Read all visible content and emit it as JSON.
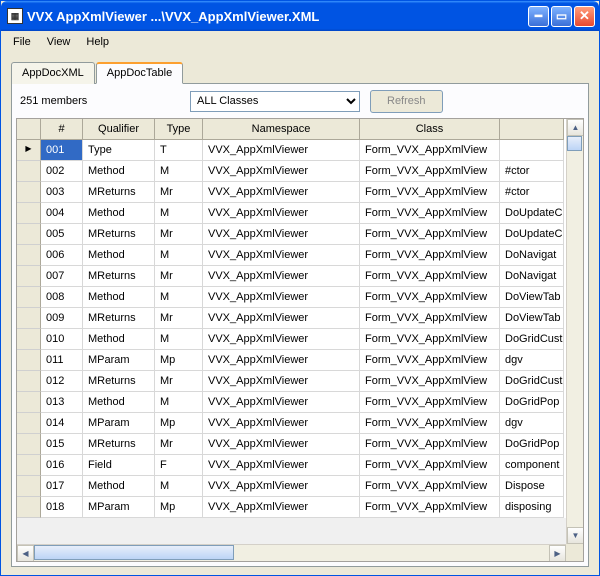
{
  "window": {
    "title": "VVX AppXmlViewer ...\\VVX_AppXmlViewer.XML"
  },
  "menu": {
    "file": "File",
    "view": "View",
    "help": "Help"
  },
  "tabs": {
    "xml": "AppDocXML",
    "table": "AppDocTable"
  },
  "toolbar": {
    "members": "251 members",
    "filter": "ALL Classes",
    "refresh": "Refresh"
  },
  "columns": [
    "#",
    "Qualifier",
    "Type",
    "Namespace",
    "Class",
    ""
  ],
  "rows": [
    {
      "n": "001",
      "q": "Type",
      "t": "T",
      "ns": "VVX_AppXmlViewer",
      "cls": "Form_VVX_AppXmlView",
      "m": ""
    },
    {
      "n": "002",
      "q": "Method",
      "t": "M",
      "ns": "VVX_AppXmlViewer",
      "cls": "Form_VVX_AppXmlView",
      "m": "#ctor"
    },
    {
      "n": "003",
      "q": "MReturns",
      "t": "Mr",
      "ns": "VVX_AppXmlViewer",
      "cls": "Form_VVX_AppXmlView",
      "m": "#ctor"
    },
    {
      "n": "004",
      "q": "Method",
      "t": "M",
      "ns": "VVX_AppXmlViewer",
      "cls": "Form_VVX_AppXmlView",
      "m": "DoUpdateC"
    },
    {
      "n": "005",
      "q": "MReturns",
      "t": "Mr",
      "ns": "VVX_AppXmlViewer",
      "cls": "Form_VVX_AppXmlView",
      "m": "DoUpdateC"
    },
    {
      "n": "006",
      "q": "Method",
      "t": "M",
      "ns": "VVX_AppXmlViewer",
      "cls": "Form_VVX_AppXmlView",
      "m": "DoNavigat"
    },
    {
      "n": "007",
      "q": "MReturns",
      "t": "Mr",
      "ns": "VVX_AppXmlViewer",
      "cls": "Form_VVX_AppXmlView",
      "m": "DoNavigat"
    },
    {
      "n": "008",
      "q": "Method",
      "t": "M",
      "ns": "VVX_AppXmlViewer",
      "cls": "Form_VVX_AppXmlView",
      "m": "DoViewTab"
    },
    {
      "n": "009",
      "q": "MReturns",
      "t": "Mr",
      "ns": "VVX_AppXmlViewer",
      "cls": "Form_VVX_AppXmlView",
      "m": "DoViewTab"
    },
    {
      "n": "010",
      "q": "Method",
      "t": "M",
      "ns": "VVX_AppXmlViewer",
      "cls": "Form_VVX_AppXmlView",
      "m": "DoGridCust"
    },
    {
      "n": "011",
      "q": "MParam",
      "t": "Mp",
      "ns": "VVX_AppXmlViewer",
      "cls": "Form_VVX_AppXmlView",
      "m": "dgv"
    },
    {
      "n": "012",
      "q": "MReturns",
      "t": "Mr",
      "ns": "VVX_AppXmlViewer",
      "cls": "Form_VVX_AppXmlView",
      "m": "DoGridCust"
    },
    {
      "n": "013",
      "q": "Method",
      "t": "M",
      "ns": "VVX_AppXmlViewer",
      "cls": "Form_VVX_AppXmlView",
      "m": "DoGridPop"
    },
    {
      "n": "014",
      "q": "MParam",
      "t": "Mp",
      "ns": "VVX_AppXmlViewer",
      "cls": "Form_VVX_AppXmlView",
      "m": "dgv"
    },
    {
      "n": "015",
      "q": "MReturns",
      "t": "Mr",
      "ns": "VVX_AppXmlViewer",
      "cls": "Form_VVX_AppXmlView",
      "m": "DoGridPop"
    },
    {
      "n": "016",
      "q": "Field",
      "t": "F",
      "ns": "VVX_AppXmlViewer",
      "cls": "Form_VVX_AppXmlView",
      "m": "component"
    },
    {
      "n": "017",
      "q": "Method",
      "t": "M",
      "ns": "VVX_AppXmlViewer",
      "cls": "Form_VVX_AppXmlView",
      "m": "Dispose"
    },
    {
      "n": "018",
      "q": "MParam",
      "t": "Mp",
      "ns": "VVX_AppXmlViewer",
      "cls": "Form_VVX_AppXmlView",
      "m": "disposing"
    }
  ]
}
